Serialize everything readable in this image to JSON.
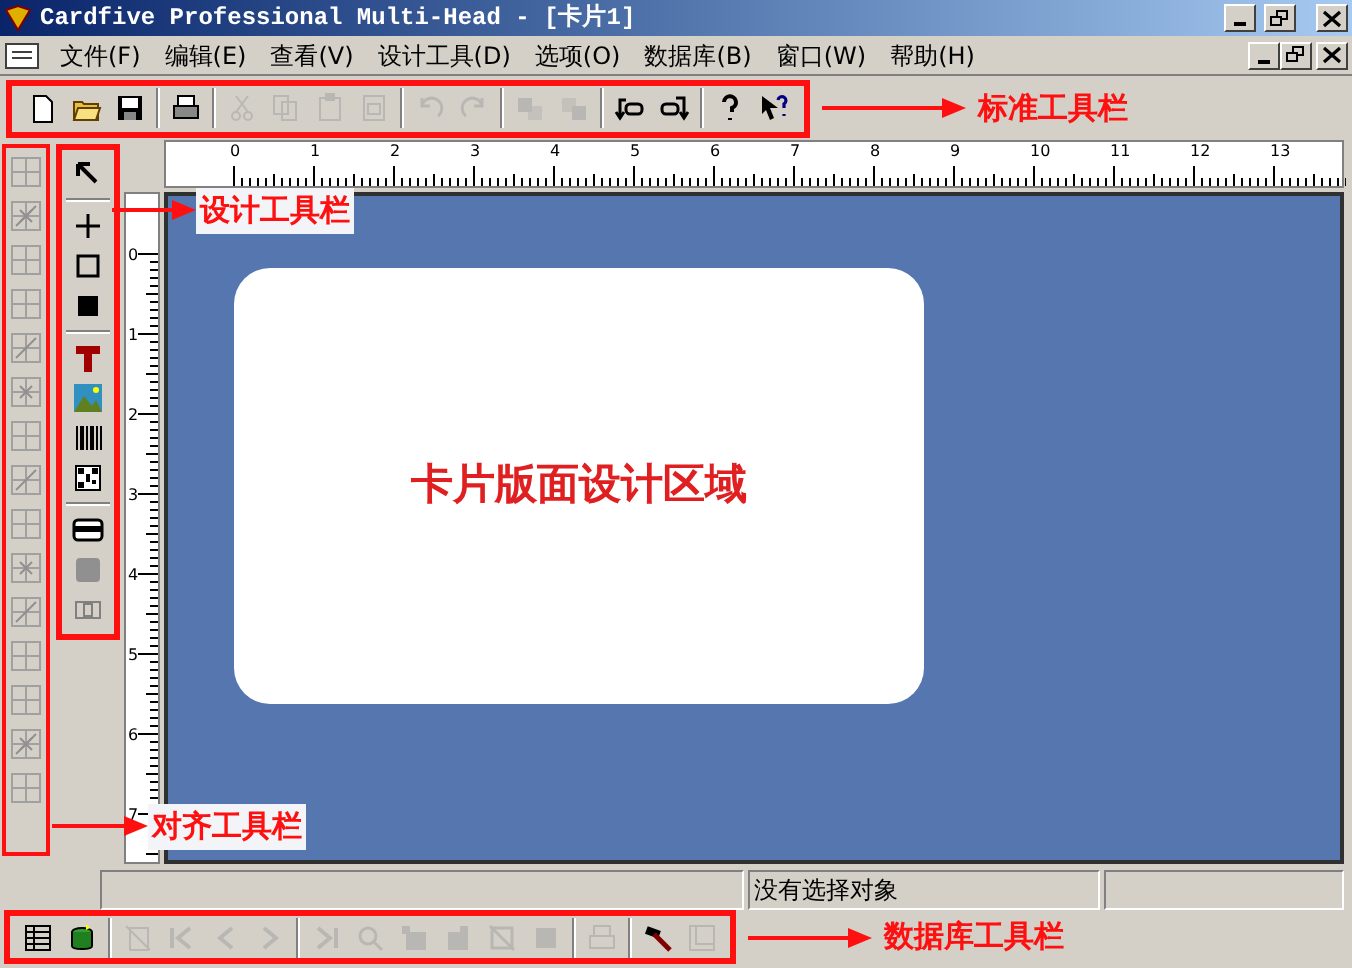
{
  "window": {
    "title": "Cardfive Professional Multi-Head - [卡片1]"
  },
  "menu": [
    "文件(F)",
    "编辑(E)",
    "查看(V)",
    "设计工具(D)",
    "选项(O)",
    "数据库(B)",
    "窗口(W)",
    "帮助(H)"
  ],
  "standard_toolbar": {
    "buttons": [
      {
        "disabled": false
      },
      {
        "disabled": false
      },
      {
        "disabled": false
      },
      {
        "disabled": false
      },
      {
        "disabled": true
      },
      {
        "disabled": true
      },
      {
        "disabled": true
      },
      {
        "disabled": true
      },
      {
        "disabled": true
      },
      {
        "disabled": true
      },
      {
        "disabled": true
      },
      {
        "disabled": true
      },
      {
        "disabled": false
      },
      {
        "disabled": false
      },
      {
        "disabled": false
      },
      {
        "disabled": false
      }
    ]
  },
  "horizontal_ruler": [
    "0",
    "1",
    "2",
    "3",
    "4",
    "5",
    "6",
    "7",
    "8",
    "9",
    "10",
    "11",
    "12",
    "13"
  ],
  "vertical_ruler": [
    "0",
    "1",
    "2",
    "3",
    "4",
    "5",
    "6",
    "7"
  ],
  "card": {
    "text": "卡片版面设计区域"
  },
  "status_bar": [
    "没有选择对象"
  ],
  "database_toolbar": {
    "buttons": [
      {
        "disabled": false
      },
      {
        "disabled": false
      },
      {
        "disabled": true
      },
      {
        "disabled": true
      },
      {
        "disabled": true
      },
      {
        "disabled": true
      },
      {
        "disabled": true
      },
      {
        "disabled": true
      },
      {
        "disabled": true
      },
      {
        "disabled": true
      },
      {
        "disabled": true
      },
      {
        "disabled": true
      },
      {
        "disabled": true
      },
      {
        "disabled": false
      },
      {
        "disabled": true
      }
    ]
  },
  "annotations": [
    "标准工具栏",
    "设计工具栏",
    "对齐工具栏",
    "数据库工具栏"
  ]
}
